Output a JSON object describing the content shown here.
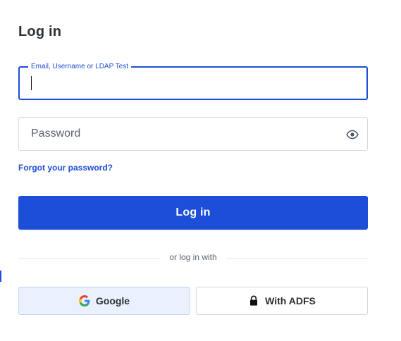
{
  "login": {
    "title": "Log in",
    "email_label": "Email, Username or LDAP Test",
    "email_value": "",
    "password_placeholder": "Password",
    "password_value": "",
    "forgot_link": "Forgot your password?",
    "submit_label": "Log in",
    "divider_text": "or log in with",
    "sso": [
      {
        "label": "Google",
        "icon": "google-icon"
      },
      {
        "label": "With ADFS",
        "icon": "lock-icon"
      }
    ]
  },
  "colors": {
    "accent": "#1d4ed8",
    "google_bg": "#eaf1fd"
  }
}
